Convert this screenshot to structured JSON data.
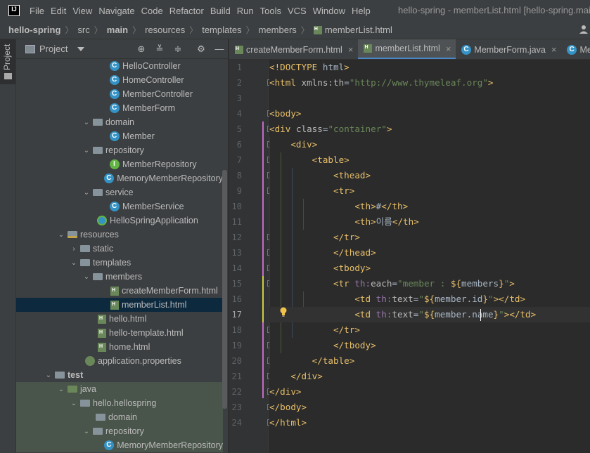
{
  "menubar": {
    "logo_text": "IJ",
    "items": [
      "File",
      "Edit",
      "View",
      "Navigate",
      "Code",
      "Refactor",
      "Build",
      "Run",
      "Tools",
      "VCS",
      "Window",
      "Help"
    ],
    "window_title": "hello-spring - memberList.html [hello-spring.main]"
  },
  "navbar": {
    "crumbs": [
      "hello-spring",
      "src",
      "main",
      "resources",
      "templates",
      "members",
      "memberList.html"
    ]
  },
  "left_strip": {
    "project_label": "Project"
  },
  "project_panel": {
    "title": "Project",
    "tree": [
      {
        "label": "HelloController",
        "icon": "class-icon"
      },
      {
        "label": "HomeController",
        "icon": "class-icon"
      },
      {
        "label": "MemberController",
        "icon": "class-icon"
      },
      {
        "label": "MemberForm",
        "icon": "class-icon"
      },
      {
        "label": "domain",
        "icon": "folder-icon"
      },
      {
        "label": "Member",
        "icon": "class-icon"
      },
      {
        "label": "repository",
        "icon": "folder-icon"
      },
      {
        "label": "MemberRepository",
        "icon": "interface-icon"
      },
      {
        "label": "MemoryMemberRepository",
        "icon": "class-icon"
      },
      {
        "label": "service",
        "icon": "folder-icon"
      },
      {
        "label": "MemberService",
        "icon": "class-icon"
      },
      {
        "label": "HelloSpringApplication",
        "icon": "spring-app-icon"
      },
      {
        "label": "resources",
        "icon": "resources-folder-icon"
      },
      {
        "label": "static",
        "icon": "folder-icon"
      },
      {
        "label": "templates",
        "icon": "folder-icon"
      },
      {
        "label": "members",
        "icon": "folder-icon"
      },
      {
        "label": "createMemberForm.html",
        "icon": "html-file-icon"
      },
      {
        "label": "memberList.html",
        "icon": "html-file-icon"
      },
      {
        "label": "hello.html",
        "icon": "html-file-icon"
      },
      {
        "label": "hello-template.html",
        "icon": "html-file-icon"
      },
      {
        "label": "home.html",
        "icon": "html-file-icon"
      },
      {
        "label": "application.properties",
        "icon": "properties-icon"
      },
      {
        "label": "test",
        "icon": "folder-icon"
      },
      {
        "label": "java",
        "icon": "test-source-folder-icon"
      },
      {
        "label": "hello.hellospring",
        "icon": "package-icon"
      },
      {
        "label": "domain",
        "icon": "package-icon"
      },
      {
        "label": "repository",
        "icon": "package-icon"
      },
      {
        "label": "MemoryMemberRepository",
        "icon": "class-icon"
      }
    ]
  },
  "editor": {
    "tabs": [
      {
        "label": "createMemberForm.html",
        "active": false
      },
      {
        "label": "memberList.html",
        "active": true
      },
      {
        "label": "MemberForm.java",
        "active": false
      },
      {
        "label": "Me",
        "active": false
      }
    ],
    "current_line": 17,
    "lines": [
      "<!DOCTYPE html>",
      "<html xmlns:th=\"http://www.thymeleaf.org\">",
      "",
      "<body>",
      "<div class=\"container\">",
      "    <div>",
      "        <table>",
      "            <thead>",
      "            <tr>",
      "                <th>#</th>",
      "                <th>이름</th>",
      "            </tr>",
      "            </thead>",
      "            <tbody>",
      "            <tr th:each=\"member : ${members}\">",
      "                <td th:text=\"${member.id}\"></td>",
      "                <td th:text=\"${member.name}\"></td>",
      "            </tr>",
      "            </tbody>",
      "        </table>",
      "    </div>",
      "</div>",
      "</body>",
      "</html>"
    ]
  }
}
